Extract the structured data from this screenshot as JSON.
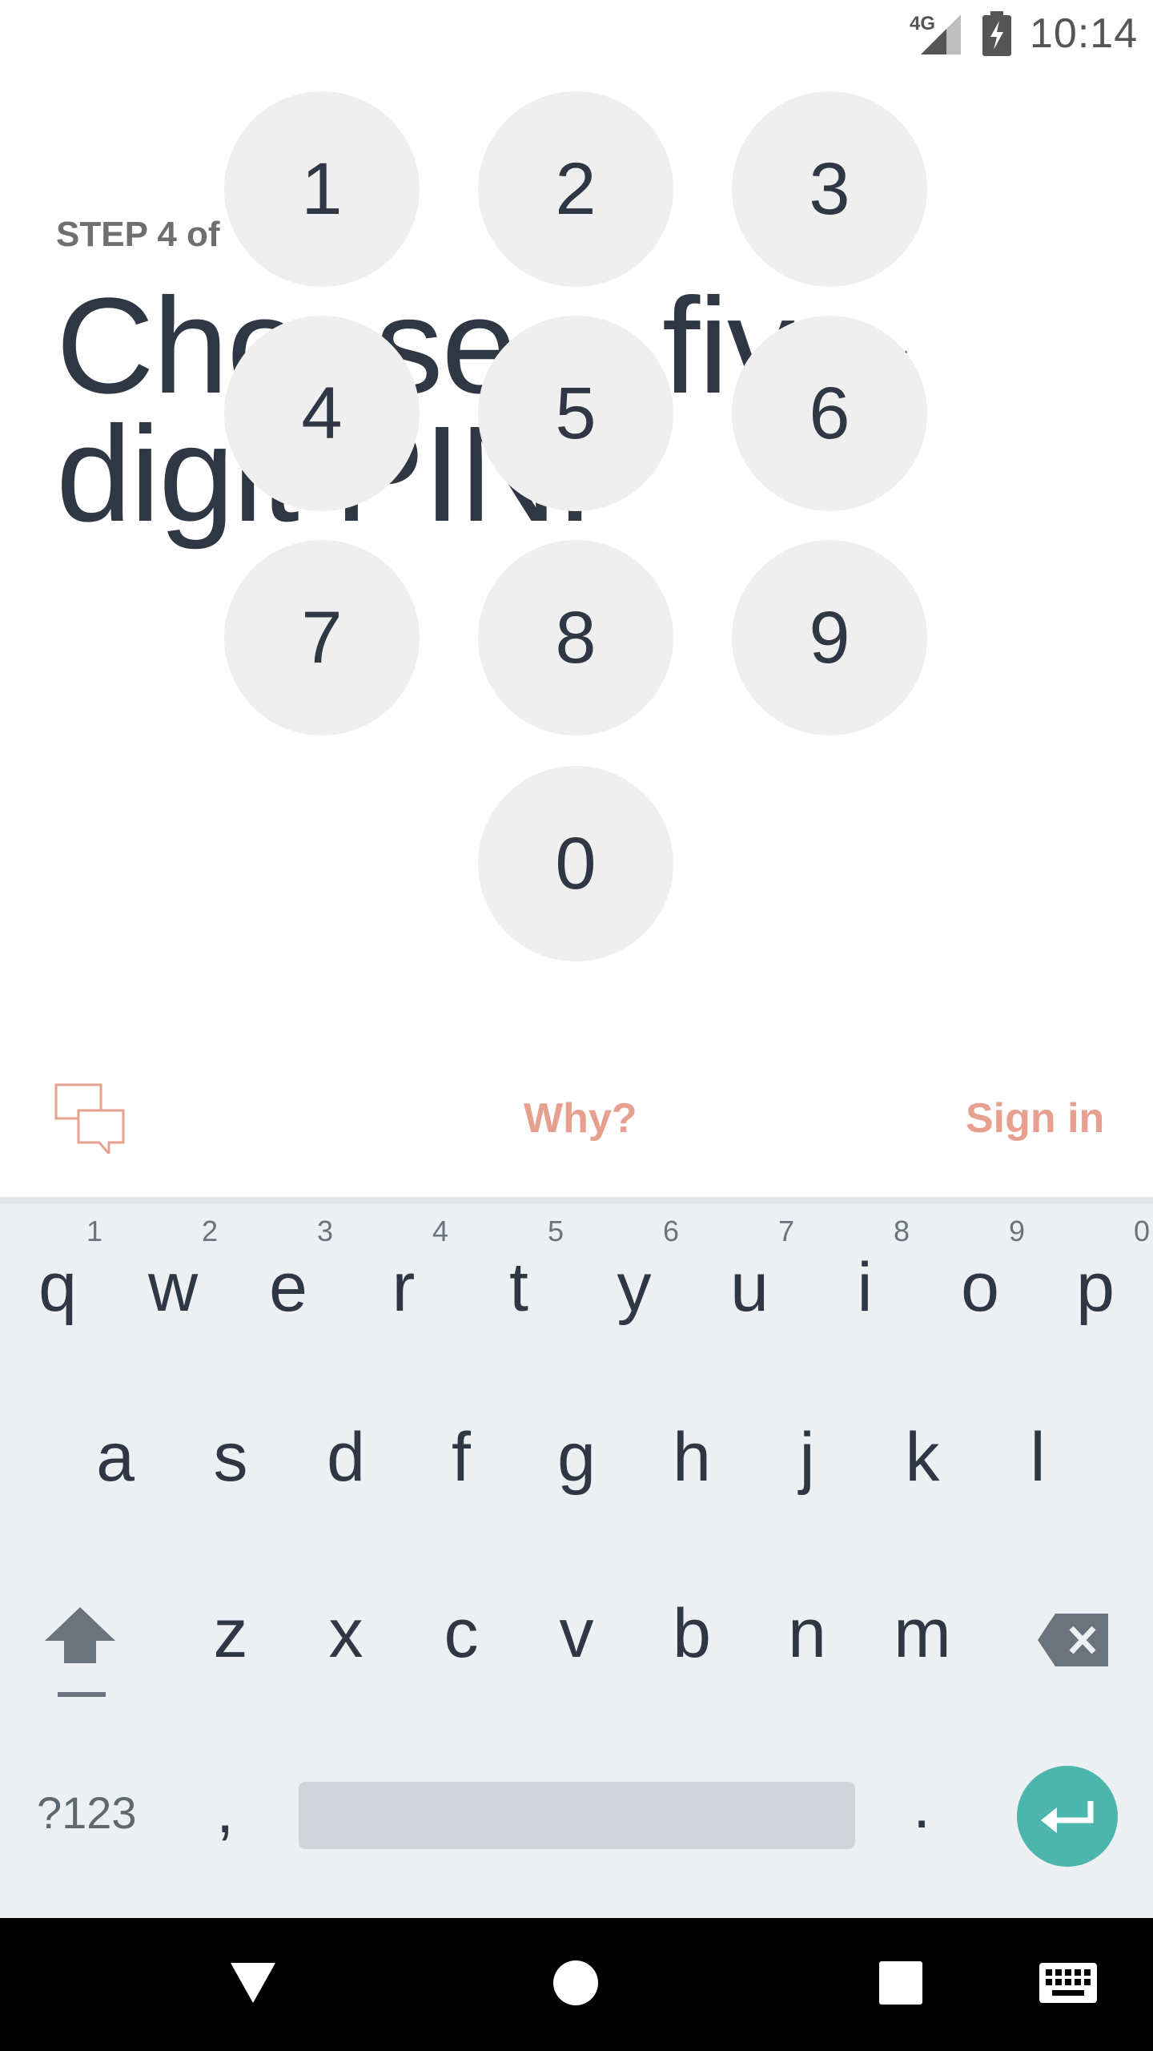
{
  "status_bar": {
    "network": "4G",
    "time": "10:14",
    "icons": [
      "signal-icon",
      "battery-charging-icon"
    ]
  },
  "header": {
    "step_label": "STEP 4 of",
    "title": "Choose a five-digit PIN."
  },
  "keypad": {
    "keys": [
      "1",
      "2",
      "3",
      "4",
      "5",
      "6",
      "7",
      "8",
      "9",
      "0"
    ]
  },
  "actions": {
    "chat_icon": "chat-bubbles-icon",
    "why_label": "Why?",
    "signin_label": "Sign in",
    "accent_color": "#e7a08f"
  },
  "keyboard": {
    "row1": [
      {
        "char": "q",
        "hint": "1"
      },
      {
        "char": "w",
        "hint": "2"
      },
      {
        "char": "e",
        "hint": "3"
      },
      {
        "char": "r",
        "hint": "4"
      },
      {
        "char": "t",
        "hint": "5"
      },
      {
        "char": "y",
        "hint": "6"
      },
      {
        "char": "u",
        "hint": "7"
      },
      {
        "char": "i",
        "hint": "8"
      },
      {
        "char": "o",
        "hint": "9"
      },
      {
        "char": "p",
        "hint": "0"
      }
    ],
    "row2": [
      "a",
      "s",
      "d",
      "f",
      "g",
      "h",
      "j",
      "k",
      "l"
    ],
    "row3": [
      "z",
      "x",
      "c",
      "v",
      "b",
      "n",
      "m"
    ],
    "sym_label": "?123",
    "comma_label": ",",
    "period_label": ".",
    "enter_color": "#4db6ac"
  },
  "nav_bar": {
    "buttons": [
      "back-icon",
      "home-icon",
      "recents-icon",
      "keyboard-icon"
    ]
  }
}
